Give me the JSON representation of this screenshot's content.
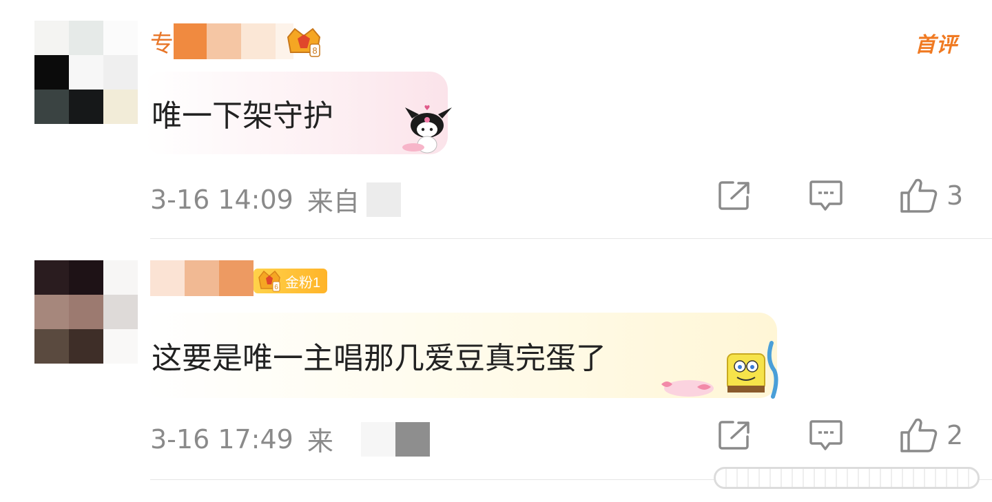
{
  "comments": [
    {
      "username_visible_text": "专",
      "badge": {
        "icon": "fan-crown-icon",
        "level": "8",
        "text": ""
      },
      "first_comment_tag": "首评",
      "text": "唯一下架守护",
      "time": "3-16 14:09",
      "source_prefix": "来自",
      "sticker": "kuromi-sticker-icon",
      "like_count": "3"
    },
    {
      "username_visible_text": "",
      "badge": {
        "icon": "fan-crown-icon",
        "level": "6",
        "text": "金粉1"
      },
      "text": "这要是唯一主唱那几爱豆真完蛋了",
      "time": "3-16 17:49",
      "source_prefix": "来",
      "sticker": "spongebob-sticker-icon",
      "like_count": "2"
    }
  ],
  "colors": {
    "username": "#e8772a",
    "meta": "#8a8a8a",
    "text": "#222222",
    "first_tag": "#f07a22",
    "badge_gold": "#ffb429"
  },
  "icons": {
    "share": "share-icon",
    "comment": "comment-icon",
    "like": "thumbs-up-icon"
  }
}
